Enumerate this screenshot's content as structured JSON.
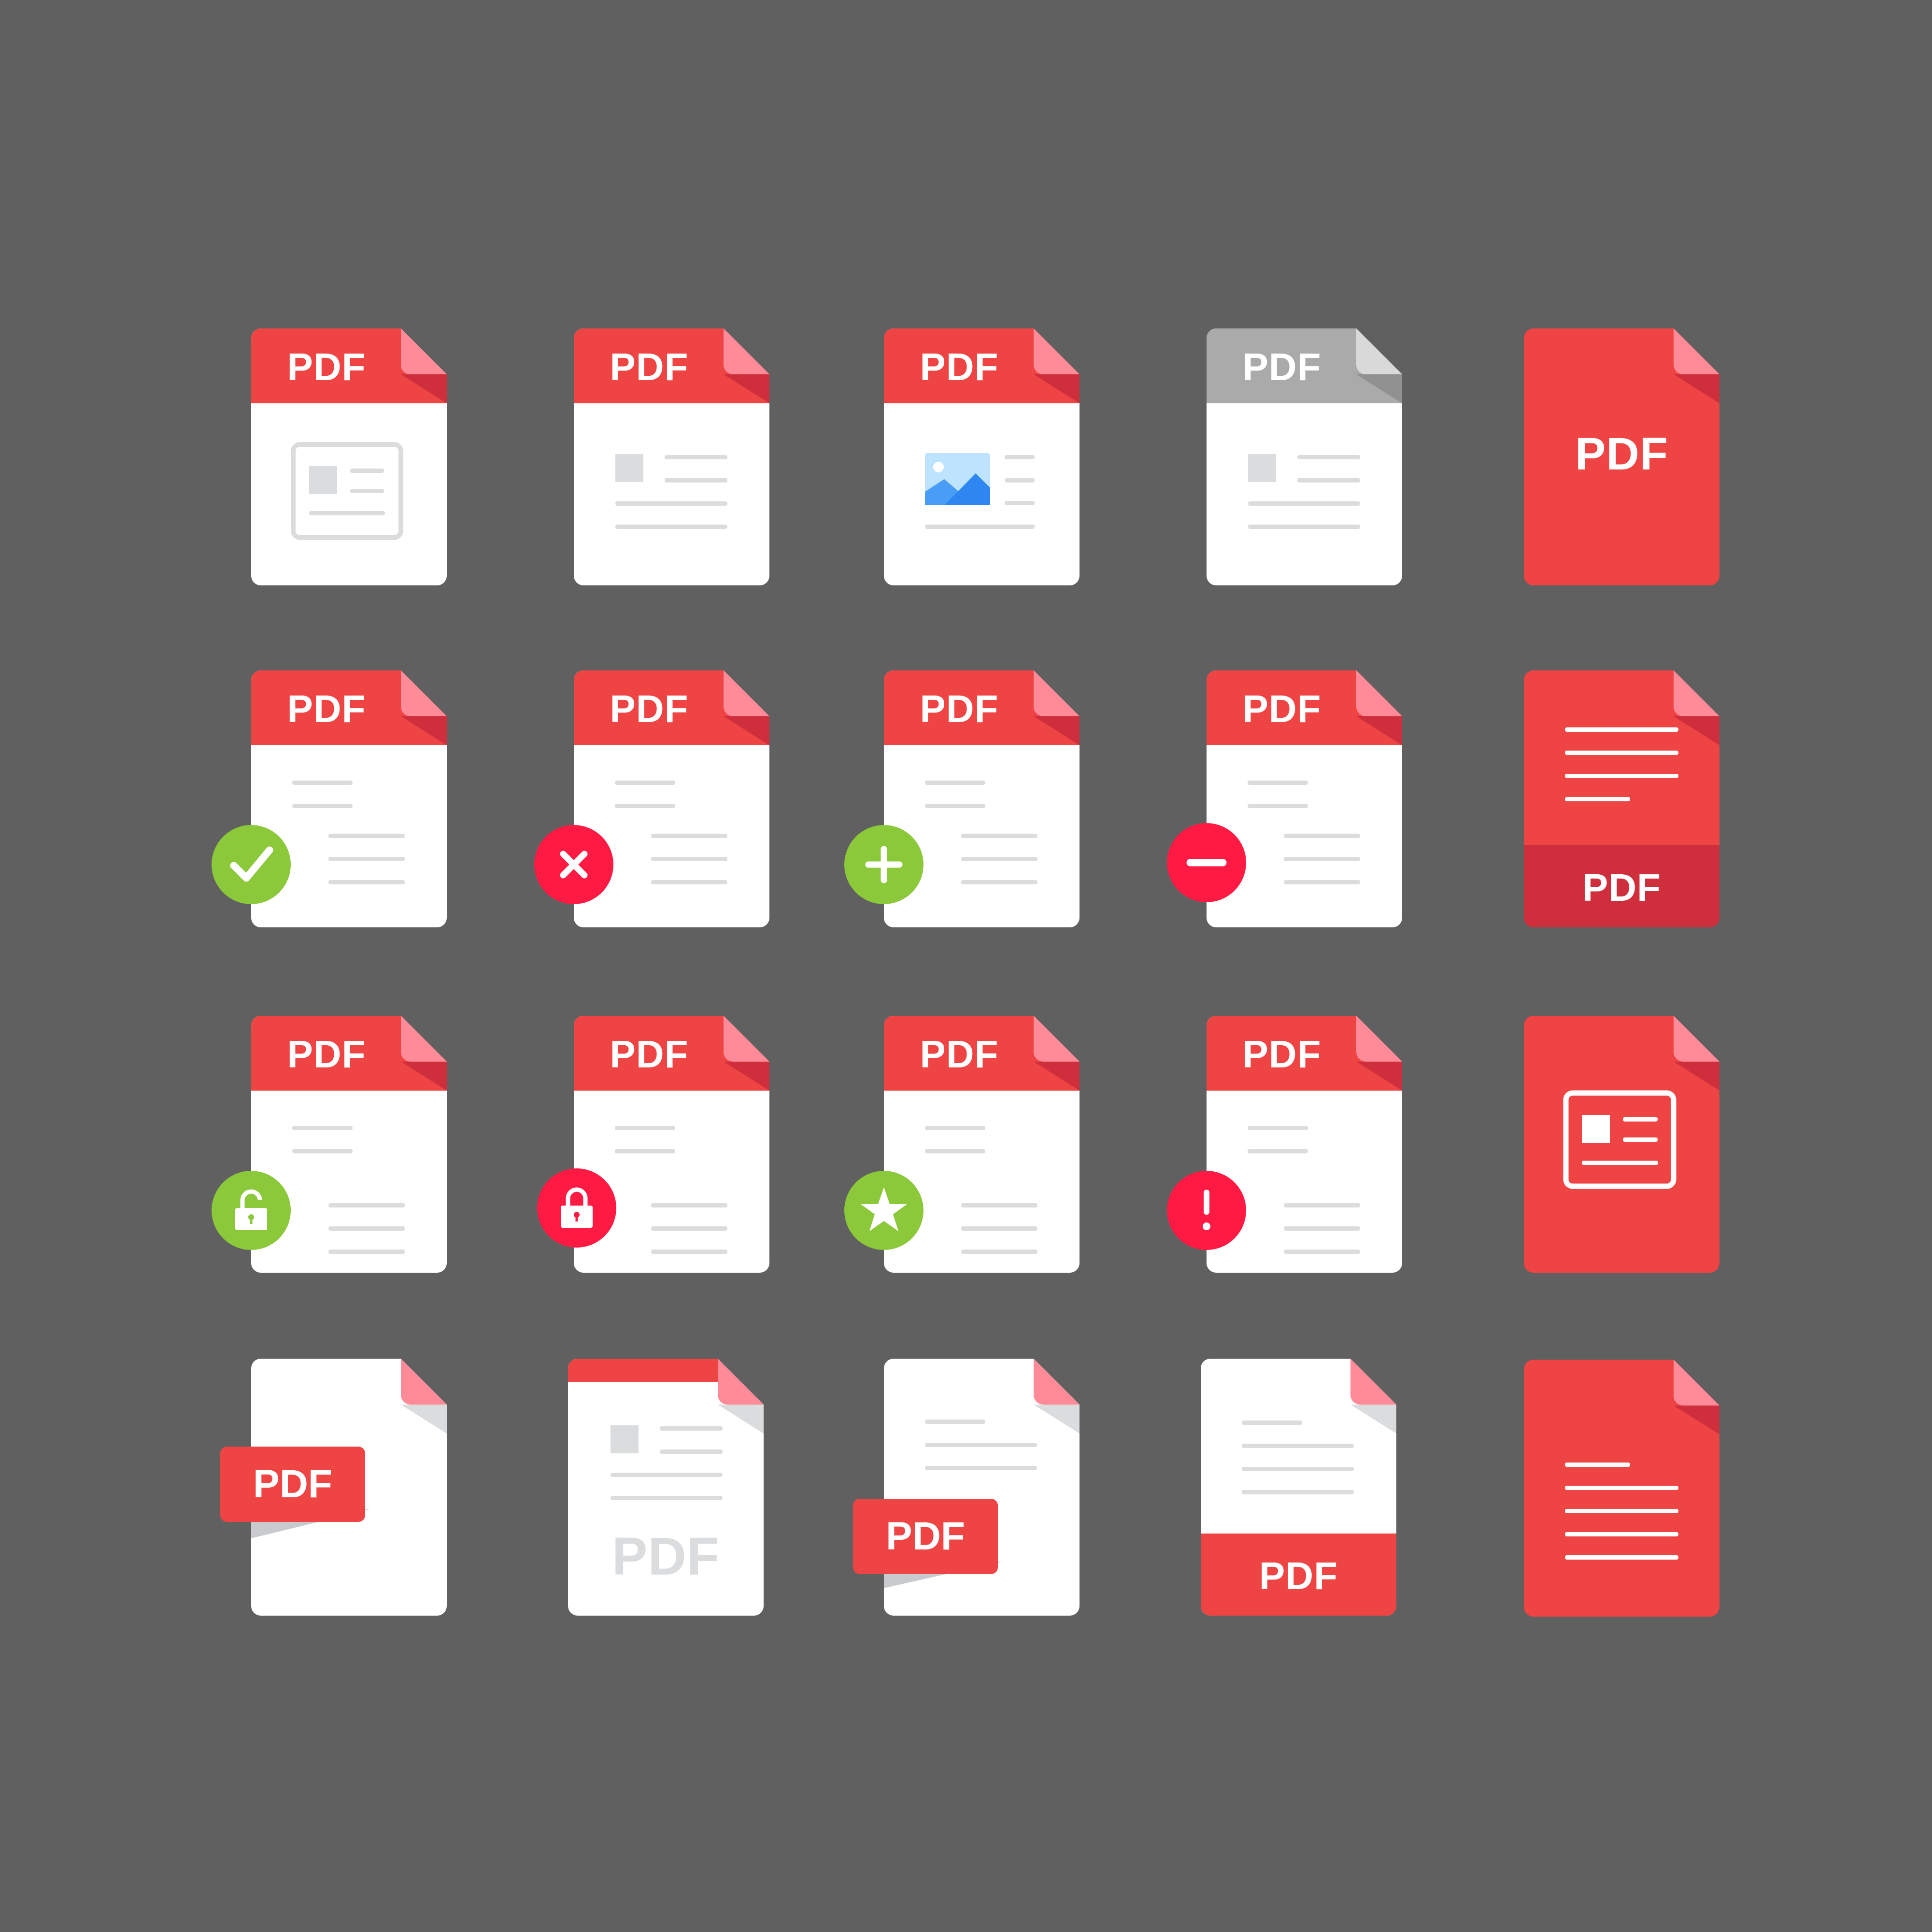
{
  "colors": {
    "background": "#606060",
    "page": "#ffffff",
    "red": "#ef4444",
    "dark_red": "#cf2f3d",
    "fold_pink": "#ff8a98",
    "gray_header": "#aaaaaa",
    "lines": "#dadcde",
    "success_green": "#8bc83a",
    "error_red": "#ff1a43"
  },
  "icons": [
    {
      "name": "pdf-file-icon",
      "label": "PDF",
      "content": "card"
    },
    {
      "name": "pdf-file-icon",
      "label": "PDF",
      "content": "text"
    },
    {
      "name": "pdf-file-icon",
      "label": "PDF",
      "content": "image"
    },
    {
      "name": "pdf-file-gray-icon",
      "label": "PDF",
      "content": "text"
    },
    {
      "name": "pdf-file-solid-icon",
      "label": "PDF"
    },
    {
      "name": "pdf-check-icon",
      "label": "PDF",
      "badge": "check-icon"
    },
    {
      "name": "pdf-remove-icon",
      "label": "PDF",
      "badge": "close-icon"
    },
    {
      "name": "pdf-add-icon",
      "label": "PDF",
      "badge": "plus-icon"
    },
    {
      "name": "pdf-minus-icon",
      "label": "PDF",
      "badge": "minus-icon"
    },
    {
      "name": "pdf-document-icon",
      "label": "PDF"
    },
    {
      "name": "pdf-unlocked-icon",
      "label": "PDF",
      "badge": "unlock-icon"
    },
    {
      "name": "pdf-locked-icon",
      "label": "PDF",
      "badge": "lock-icon"
    },
    {
      "name": "pdf-favorite-icon",
      "label": "PDF",
      "badge": "star-icon"
    },
    {
      "name": "pdf-warning-icon",
      "label": "PDF",
      "badge": "exclamation-icon"
    },
    {
      "name": "pdf-card-icon"
    },
    {
      "name": "pdf-tag-icon",
      "label": "PDF"
    },
    {
      "name": "pdf-ghost-label-icon",
      "label": "PDF"
    },
    {
      "name": "pdf-text-tag-icon",
      "label": "PDF"
    },
    {
      "name": "pdf-footer-icon",
      "label": "PDF"
    },
    {
      "name": "pdf-text-solid-icon"
    }
  ]
}
